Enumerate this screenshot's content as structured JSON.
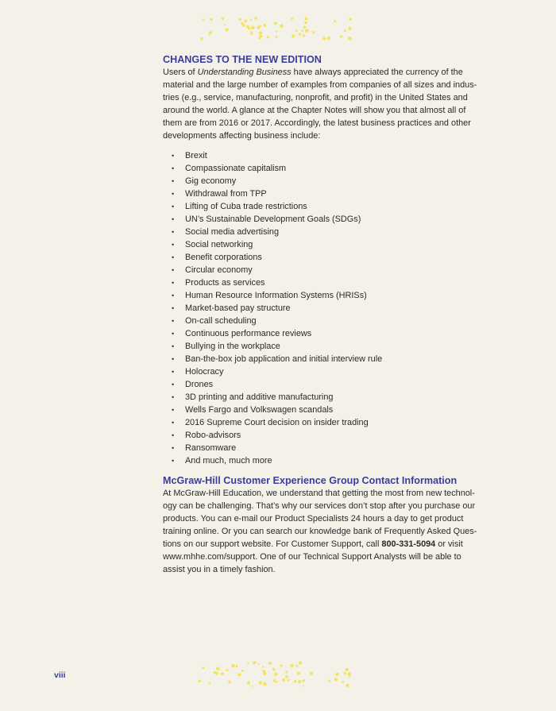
{
  "section1": {
    "heading": "CHANGES TO THE NEW EDITION",
    "intro_prefix": "Users of ",
    "intro_book_title": "Understanding Business",
    "intro_line1_rest": " have always appreciated the currency of the",
    "intro_lines": [
      "material and the large number of examples from companies of all sizes and indus-",
      "tries (e.g., service, manufacturing, nonprofit, and profit) in the United States and",
      "around the world. A glance at the Chapter Notes will show you that almost all of",
      "them are from 2016 or 2017. Accordingly, the latest business practices and other",
      "developments affecting business include:"
    ],
    "bullets": [
      "Brexit",
      "Compassionate capitalism",
      "Gig economy",
      "Withdrawal from TPP",
      "Lifting of Cuba trade restrictions",
      "UN’s Sustainable Development Goals (SDGs)",
      "Social media advertising",
      "Social networking",
      "Benefit corporations",
      "Circular economy",
      "Products as services",
      "Human Resource Information Systems (HRISs)",
      "Market-based pay structure",
      "On-call scheduling",
      "Continuous performance reviews",
      "Bullying in the workplace",
      "Ban-the-box job application and initial interview rule",
      "Holocracy",
      "Drones",
      "3D printing and additive manufacturing",
      "Wells Fargo and Volkswagen scandals",
      "2016 Supreme Court decision on insider trading",
      "Robo-advisors",
      "Ransomware",
      "And much, much more"
    ]
  },
  "section2": {
    "heading": "McGraw-Hill Customer Experience Group Contact Information",
    "lines": [
      "At McGraw-Hill Education, we understand that getting the most from new technol-",
      "ogy can be challenging. That’s why our services don’t stop after you purchase our",
      "products. You can e-mail our Product Specialists 24 hours a day to get product",
      "training online. Or you can search our knowledge bank of Frequently Asked Ques-"
    ],
    "line5_prefix": "tions on our support website. For Customer Support, call ",
    "phone": "800-331-5094",
    "line5_suffix": " or visit",
    "lines_after": [
      "www.mhhe.com/support. One of our Technical Support Analysts will be able to",
      "assist you in a timely fashion."
    ]
  },
  "footer": {
    "page_number": "viii"
  },
  "colors": {
    "heading": "#3b3d9a",
    "dots": "#f3e35a",
    "background": "#f4f2e8"
  },
  "decorations": {
    "top": "yellow-dot-pattern",
    "bottom": "yellow-dot-pattern"
  }
}
